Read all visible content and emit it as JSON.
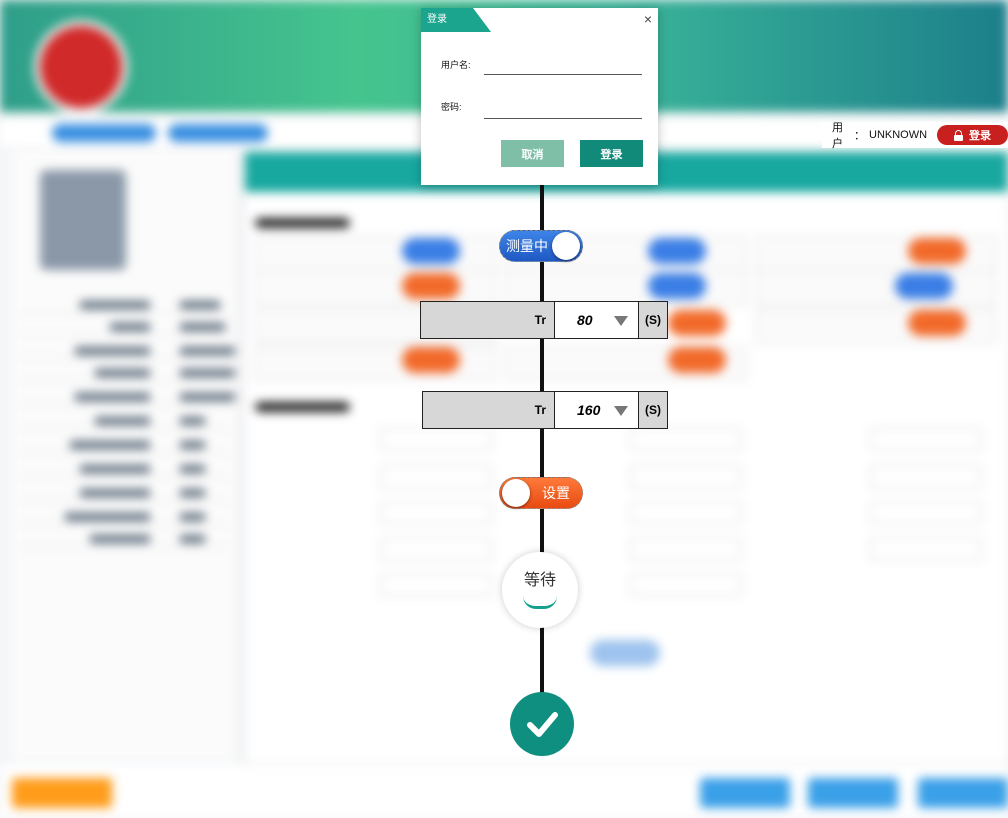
{
  "user_area": {
    "label": "用户",
    "colon": "：",
    "name": "UNKNOWN",
    "login_button": "登录"
  },
  "login_dialog": {
    "title": "登录",
    "close_glyph": "×",
    "username_label": "用户名:",
    "username_value": "",
    "password_label": "密码:",
    "password_value": "",
    "cancel_button": "取消",
    "login_button": "登录"
  },
  "flow": {
    "measure_toggle_label": "测量中",
    "tr_row_1": {
      "label": "Tr",
      "value": "80",
      "unit": "(S)"
    },
    "tr_row_2": {
      "label": "Tr",
      "value": "160",
      "unit": "(S)"
    },
    "set_toggle_label": "设置",
    "wait_label": "等待"
  },
  "colors": {
    "accent_teal": "#128a7a",
    "login_red": "#c81f1f",
    "toggle_blue": "#1f58c4",
    "toggle_orange": "#e84b12"
  }
}
